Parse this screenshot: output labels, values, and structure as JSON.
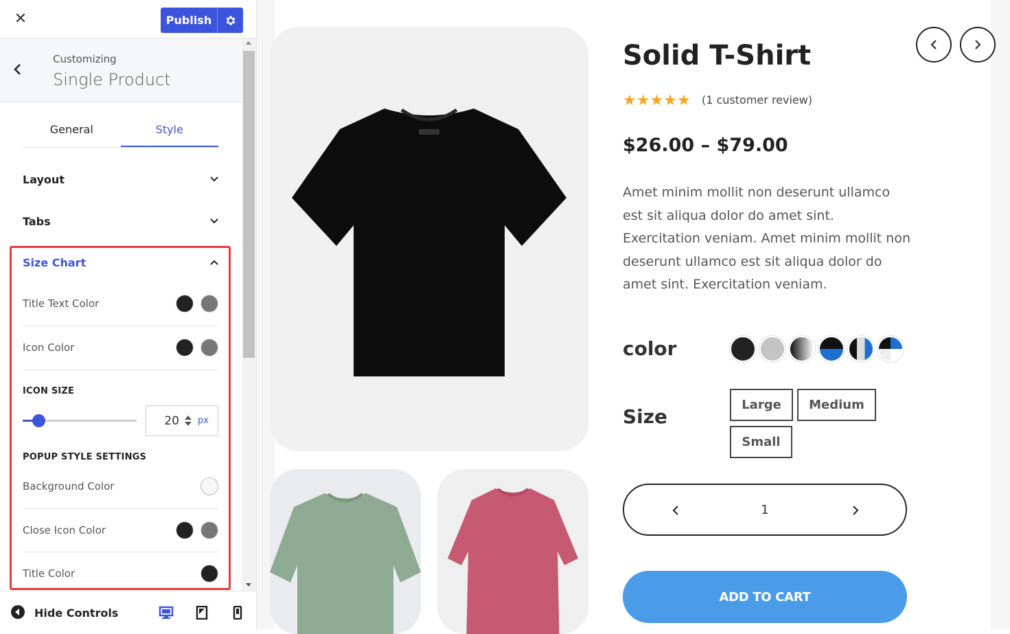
{
  "customizer": {
    "publish_label": "Publish",
    "breadcrumb_label": "Customizing",
    "section_title": "Single Product",
    "tabs": [
      "General",
      "Style"
    ],
    "active_tab": "Style",
    "accordions": {
      "layout": "Layout",
      "tabs": "Tabs",
      "size_chart": "Size Chart"
    },
    "size_chart": {
      "title_text_color": "Title Text Color",
      "icon_color": "Icon Color",
      "icon_size_heading": "ICON SIZE",
      "icon_size_value": "20",
      "icon_size_unit": "px",
      "popup_heading": "POPUP STYLE SETTINGS",
      "background_color": "Background Color",
      "close_icon_color": "Close Icon Color",
      "title_color": "Title Color"
    },
    "footer": {
      "hide_controls": "Hide Controls"
    },
    "colors": {
      "accent": "#3c55dc",
      "highlight": "#e13b3b",
      "dark_swatch": "#222222",
      "gray_swatch": "#777777",
      "light_swatch": "#f7f7f7"
    }
  },
  "product": {
    "title": "Solid T-Shirt",
    "rating": 5,
    "review_text": "(1 customer review)",
    "price": "$26.00 – $79.00",
    "description": "Amet minim mollit non deserunt ullamco est sit aliqua dolor do amet sint. Exercitation veniam. Amet minim mollit non deserunt ullamco est sit aliqua dolor do amet sint. Exercitation veniam.",
    "color_label": "color",
    "size_label": "Size",
    "sizes": [
      "Large",
      "Medium",
      "Small"
    ],
    "quantity": "1",
    "add_to_cart": "ADD TO CART",
    "colors": {
      "cart_button": "#4a9be8",
      "star": "#f5a623"
    }
  }
}
